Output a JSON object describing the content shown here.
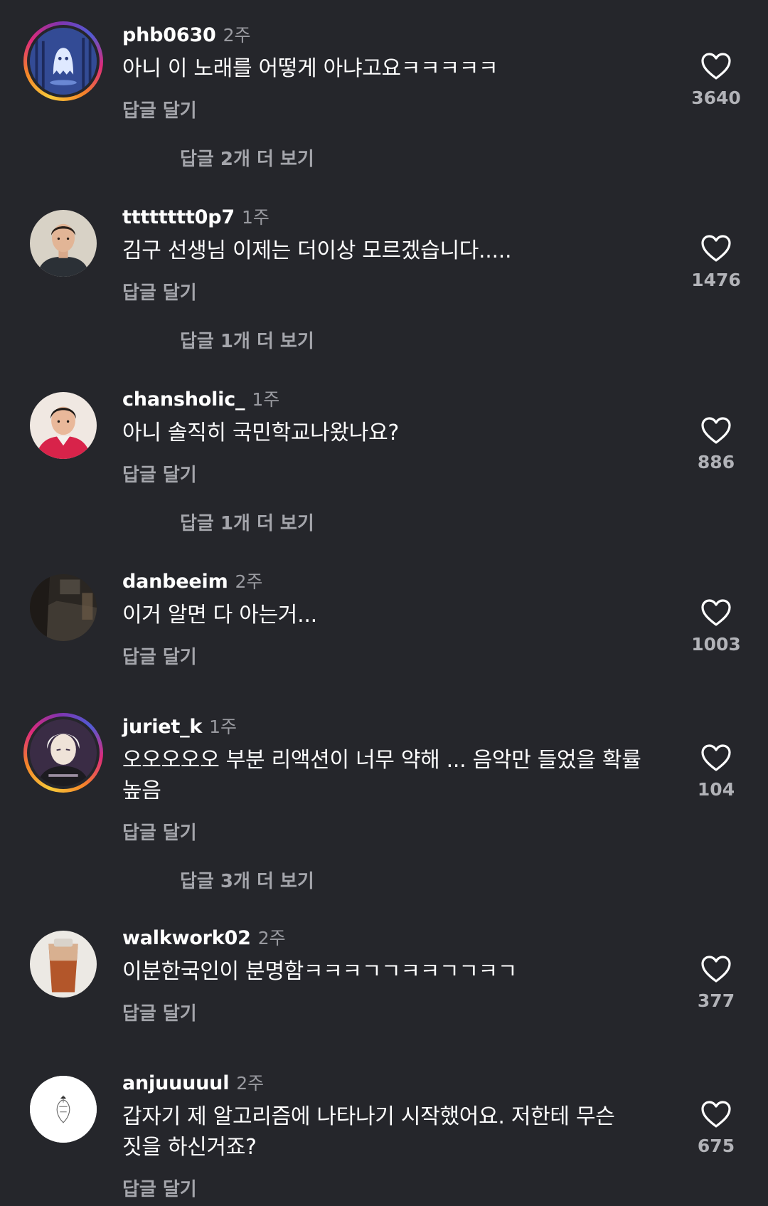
{
  "comments": [
    {
      "username": "phb0630",
      "time": "2주",
      "text": "아니 이 노래를 어떻게 아냐고요ㅋㅋㅋㅋㅋ",
      "reply_label": "답글 달기",
      "more_replies": "답글 2개 더 보기",
      "likes": "3640"
    },
    {
      "username": "tttttttt0p7",
      "time": "1주",
      "text": "김구 선생님 이제는 더이상 모르겠습니다.....",
      "reply_label": "답글 달기",
      "more_replies": "답글 1개 더 보기",
      "likes": "1476"
    },
    {
      "username": "chansholic_",
      "time": "1주",
      "text": "아니 솔직히 국민학교나왔나요?",
      "reply_label": "답글 달기",
      "more_replies": "답글 1개 더 보기",
      "likes": "886"
    },
    {
      "username": "danbeeim",
      "time": "2주",
      "text": "이거 알면 다 아는거...",
      "reply_label": "답글 달기",
      "likes": "1003"
    },
    {
      "username": "juriet_k",
      "time": "1주",
      "text": "오오오오오 부분 리액션이 너무 약해 ... 음악만 들었을 확률 높음",
      "reply_label": "답글 달기",
      "more_replies": "답글 3개 더 보기",
      "likes": "104"
    },
    {
      "username": "walkwork02",
      "time": "2주",
      "text": "이분한국인이 분명함ㅋㅋㅋㄱㄱㅋㅋㄱㄱㅋㄱ",
      "reply_label": "답글 달기",
      "likes": "377"
    },
    {
      "username": "anjuuuuul",
      "time": "2주",
      "text": "갑자기 제 알고리즘에 나타나기 시작했어요. 저한테 무슨 짓을 하신거죠?",
      "reply_label": "답글 달기",
      "likes": "675"
    }
  ],
  "colors": {
    "background": "#25262b",
    "username": "#ffffff",
    "secondary_text": "#a4a5ab",
    "heart_outline": "#ffffff",
    "story_ring": [
      "#f7c93a",
      "#f58529",
      "#dd2a7b",
      "#8134af",
      "#515bd4"
    ]
  },
  "icons": {
    "like": "heart-outline-icon"
  }
}
